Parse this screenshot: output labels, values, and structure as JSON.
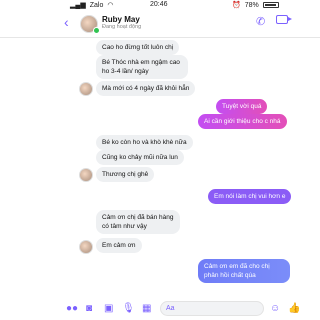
{
  "statusbar": {
    "carrier": "Zalo",
    "time": "20:46",
    "battery": "78%"
  },
  "header": {
    "name": "Ruby May",
    "status": "Đang hoạt động"
  },
  "messages": [
    {
      "side": "recv",
      "text": "Cao ho đừng tốt luôn chị"
    },
    {
      "side": "recv",
      "text": "Bé Thóc nhà em ngậm cao ho 3-4 lần/ ngày"
    },
    {
      "side": "recv",
      "text": "Mà mới có 4 ngày đã khỏi hẳn"
    },
    {
      "side": "sent",
      "text": "Tuyệt vời quá"
    },
    {
      "side": "sent",
      "text": "Ai cần giới thiệu cho c nhá"
    },
    {
      "side": "recv",
      "text": "Bé ko còn ho và khò khè nữa"
    },
    {
      "side": "recv",
      "text": "Cũng ko chảy mũi nữa lun"
    },
    {
      "side": "recv",
      "text": "Thương chị ghê"
    },
    {
      "side": "sent",
      "text": "Em nói làm chị vui hơn e"
    },
    {
      "side": "recv",
      "text": "Cảm ơn chị đã bán hàng có tâm như vậy"
    },
    {
      "side": "recv",
      "text": "Em cảm ơn"
    },
    {
      "side": "sent",
      "text": "Cảm ơn em đã cho chị phản hồi chất qúa"
    }
  ],
  "composer": {
    "placeholder": "Aa"
  },
  "colors": {
    "accent": "#7b61ff",
    "received_bg": "#eef0f2"
  }
}
